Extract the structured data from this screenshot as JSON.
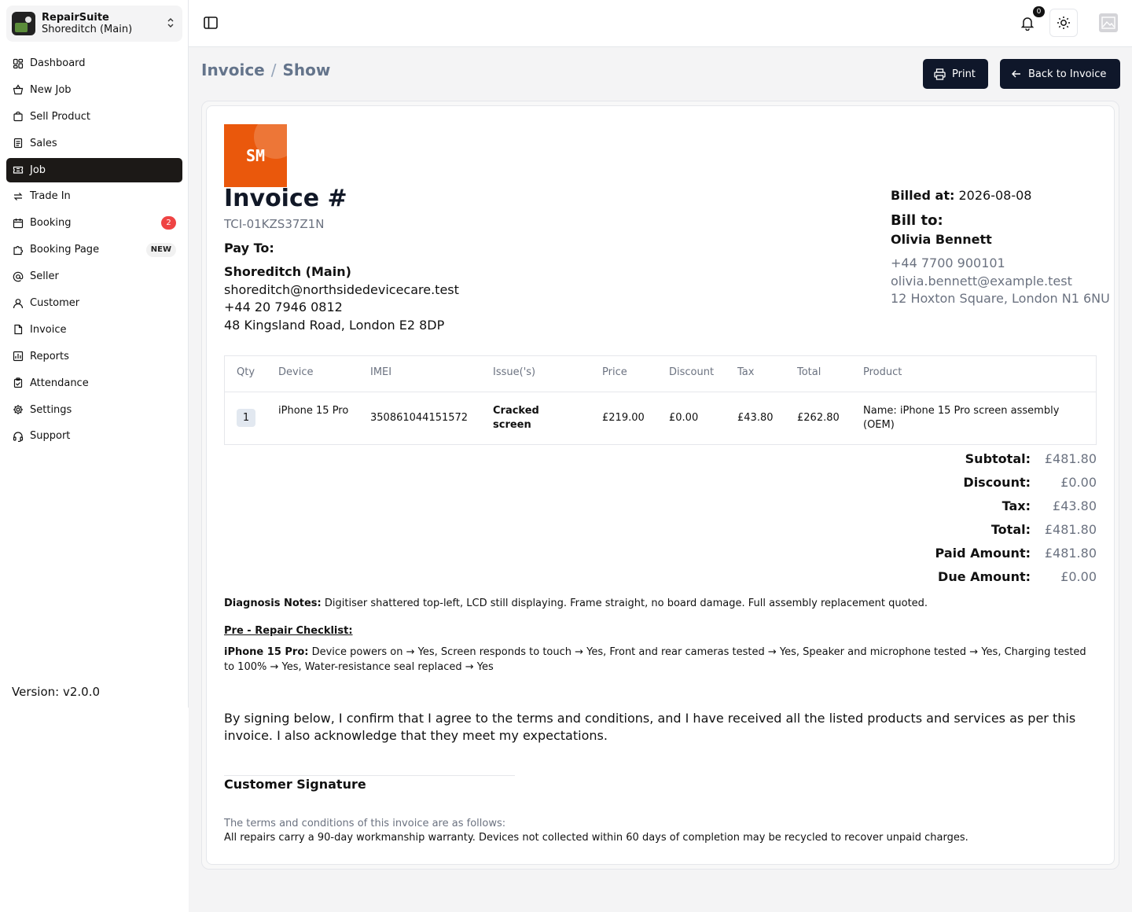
{
  "brand": {
    "name": "RepairSuite",
    "branch": "Shoreditch (Main)"
  },
  "nav": [
    {
      "label": "Dashboard",
      "icon": "dashboard-icon"
    },
    {
      "label": "New Job",
      "icon": "basket-icon"
    },
    {
      "label": "Sell Product",
      "icon": "shopping-bag-icon"
    },
    {
      "label": "Sales",
      "icon": "receipt-icon"
    },
    {
      "label": "Job",
      "icon": "ticket-icon",
      "active": true
    },
    {
      "label": "Trade In",
      "icon": "exchange-icon"
    },
    {
      "label": "Booking",
      "icon": "calendar-icon",
      "badge": "2"
    },
    {
      "label": "Booking Page",
      "icon": "puzzle-icon",
      "tag": "NEW"
    },
    {
      "label": "Seller",
      "icon": "at-icon"
    },
    {
      "label": "Customer",
      "icon": "user-icon"
    },
    {
      "label": "Invoice",
      "icon": "file-icon"
    },
    {
      "label": "Reports",
      "icon": "report-icon"
    },
    {
      "label": "Attendance",
      "icon": "clipboard-icon"
    },
    {
      "label": "Settings",
      "icon": "gear-icon"
    },
    {
      "label": "Support",
      "icon": "headset-icon"
    }
  ],
  "version": "Version: v2.0.0",
  "topbar": {
    "notification_count": "0"
  },
  "header": {
    "crumb_root": "Invoice",
    "crumb_sep": "/",
    "crumb_current": "Show",
    "print_label": "Print",
    "back_label": "Back to Invoice"
  },
  "invoice": {
    "logo_text": "SM",
    "title": "Invoice #",
    "number": "TCI-01KZS37Z1N",
    "pay_to_label": "Pay To:",
    "pay_to": {
      "name": "Shoreditch (Main)",
      "email": "shoreditch@northsidedevicecare.test",
      "phone": "+44 20 7946 0812",
      "address": "48 Kingsland Road, London E2 8DP"
    },
    "billed_at_label": "Billed at:",
    "billed_at": "2026-08-08",
    "bill_to_label": "Bill to:",
    "bill_to": {
      "name": "Olivia Bennett",
      "phone": "+44 7700 900101",
      "email": "olivia.bennett@example.test",
      "address": "12 Hoxton Square, London N1 6NU"
    },
    "table": {
      "headers": [
        "Qty",
        "Device",
        "IMEI",
        "Issue('s)",
        "Price",
        "Discount",
        "Tax",
        "Total",
        "Product"
      ],
      "row": {
        "qty": "1",
        "device": "iPhone 15 Pro",
        "imei": "350861044151572",
        "issue": "Cracked screen",
        "price": "£219.00",
        "discount": "£0.00",
        "tax": "£43.80",
        "total": "£262.80",
        "product": "Name: iPhone 15 Pro screen assembly (OEM)"
      }
    },
    "totals": [
      {
        "label": "Subtotal:",
        "value": "£481.80"
      },
      {
        "label": "Discount:",
        "value": "£0.00"
      },
      {
        "label": "Tax:",
        "value": "£43.80"
      },
      {
        "label": "Total:",
        "value": "£481.80"
      },
      {
        "label": "Paid Amount:",
        "value": "£481.80"
      },
      {
        "label": "Due Amount:",
        "value": "£0.00"
      }
    ],
    "diagnosis_label": "Diagnosis Notes:",
    "diagnosis_text": "Digitiser shattered top-left, LCD still displaying. Frame straight, no board damage. Full assembly replacement quoted.",
    "checklist_title": "Pre - Repair Checklist:",
    "checklist_device": "iPhone 15 Pro:",
    "checklist_text": "Device powers on → Yes, Screen responds to touch → Yes, Front and rear cameras tested → Yes, Speaker and microphone tested → Yes, Charging tested to 100% → Yes, Water-resistance seal replaced → Yes",
    "confirm_text": "By signing below, I confirm that I agree to the terms and conditions, and I have received all the listed products and services as per this invoice. I also acknowledge that they meet my expectations.",
    "signature_label": "Customer Signature",
    "terms_title": "The terms and conditions of this invoice are as follows:",
    "terms_text": "All repairs carry a 90-day workmanship warranty. Devices not collected within 60 days of completion may be recycled to recover unpaid charges."
  }
}
